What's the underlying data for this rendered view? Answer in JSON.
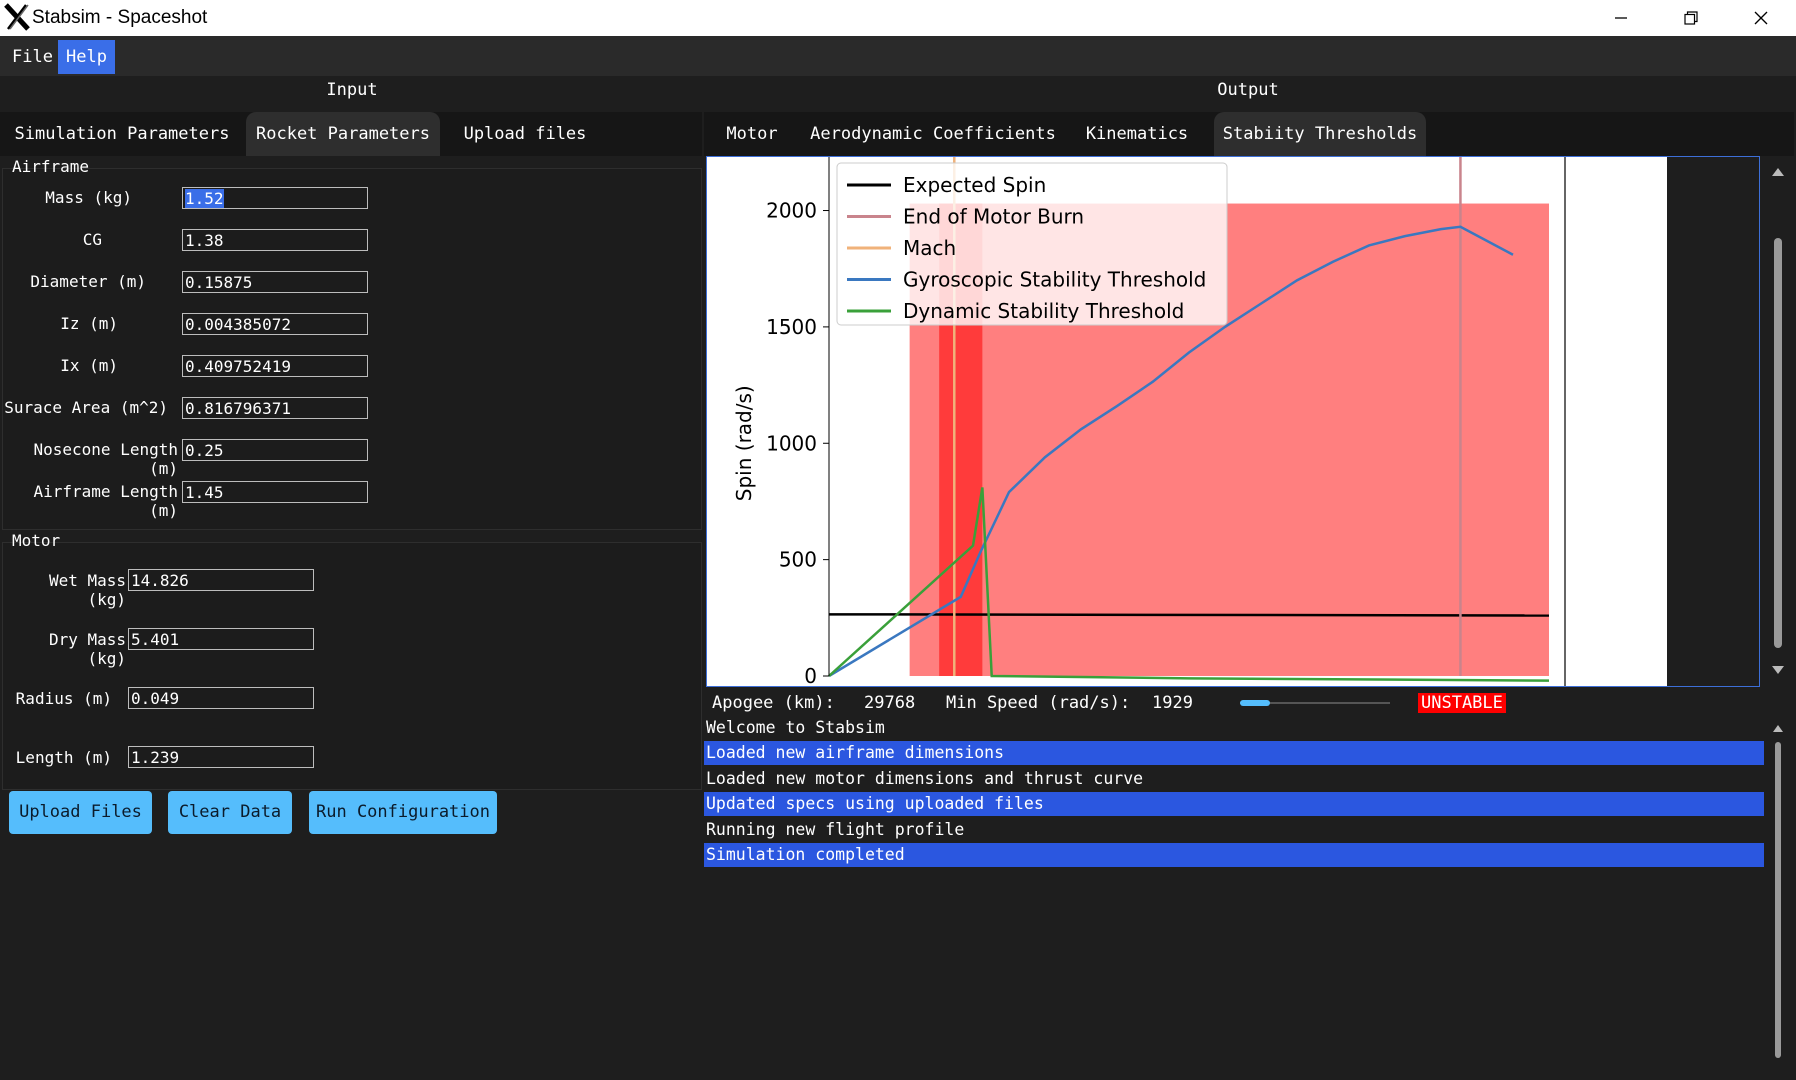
{
  "window": {
    "title": "Stabsim - Spaceshot"
  },
  "menu": {
    "items": [
      "File",
      "Help"
    ]
  },
  "panels": {
    "input_heading": "Input",
    "output_heading": "Output"
  },
  "input_tabs": [
    "Simulation Parameters",
    "Rocket Parameters",
    "Upload files"
  ],
  "input_selected_tab": "Rocket Parameters",
  "output_tabs": [
    "Motor",
    "Aerodynamic Coefficients",
    "Kinematics",
    "Stabiity Thresholds"
  ],
  "output_selected_tab": "Stabiity Thresholds",
  "airframe": {
    "label": "Airframe",
    "fields": [
      {
        "label": "Mass (kg)",
        "value": "1.52"
      },
      {
        "label": "CG",
        "value": "1.38"
      },
      {
        "label": "Diameter (m)",
        "value": "0.15875"
      },
      {
        "label": "Iz (m)",
        "value": "0.004385072"
      },
      {
        "label": "Ix (m)",
        "value": "0.409752419"
      },
      {
        "label": "Surace Area (m^2)",
        "value": "0.816796371"
      },
      {
        "label": "Nosecone Length (m)",
        "value": "0.25"
      },
      {
        "label": "Airframe Length (m)",
        "value": "1.45"
      }
    ]
  },
  "motor": {
    "label": "Motor",
    "fields": [
      {
        "label": "Wet Mass (kg)",
        "value": "14.826"
      },
      {
        "label": "Dry Mass (kg)",
        "value": "5.401"
      },
      {
        "label": "Radius (m)",
        "value": "0.049"
      },
      {
        "label": "Length (m)",
        "value": "1.239"
      }
    ]
  },
  "buttons": {
    "upload": "Upload Files",
    "clear": "Clear Data",
    "run": "Run Configuration"
  },
  "status": {
    "apogee_label": "Apogee (km):",
    "apogee_value": "29768",
    "min_speed_label": "Min Speed (rad/s):",
    "min_speed_value": "1929",
    "slider_fraction": 0.2,
    "stability": "UNSTABLE"
  },
  "log": [
    {
      "text": "Welcome to Stabsim",
      "highlight": false
    },
    {
      "text": "Loaded new airframe dimensions",
      "highlight": true
    },
    {
      "text": "Loaded new motor dimensions and thrust curve",
      "highlight": false
    },
    {
      "text": "Updated specs using uploaded files",
      "highlight": true
    },
    {
      "text": "Running new flight profile",
      "highlight": false
    },
    {
      "text": "Simulation completed",
      "highlight": true
    }
  ],
  "chart_data": {
    "type": "line",
    "ylabel": "Spin (rad/s)",
    "ylim": [
      0,
      2230
    ],
    "xlim": [
      0,
      1
    ],
    "yticks": [
      0,
      500,
      1000,
      1500,
      2000
    ],
    "legend_position": "top-left",
    "series": [
      {
        "name": "Expected Spin",
        "color": "#000000",
        "x": [
          0.0,
          1.0
        ],
        "y": [
          265,
          260
        ]
      },
      {
        "name": "End of Motor Burn",
        "color": "#c9848c",
        "x": [
          0.877,
          0.877
        ],
        "y": [
          0,
          2230
        ]
      },
      {
        "name": "Mach",
        "color": "#f0b27a",
        "x": [
          0.174,
          0.174
        ],
        "y": [
          0,
          2230
        ]
      },
      {
        "name": "Gyroscopic Stability Threshold",
        "color": "#3a78c0",
        "x": [
          0.0,
          0.183,
          0.21,
          0.25,
          0.3,
          0.35,
          0.4,
          0.45,
          0.5,
          0.55,
          0.6,
          0.65,
          0.7,
          0.75,
          0.8,
          0.85,
          0.877,
          0.95
        ],
        "y": [
          0,
          340,
          530,
          790,
          940,
          1060,
          1160,
          1265,
          1390,
          1500,
          1600,
          1700,
          1780,
          1850,
          1890,
          1920,
          1930,
          1810
        ]
      },
      {
        "name": "Dynamic Stability Threshold",
        "color": "#3aa03a",
        "x": [
          0.0,
          0.2,
          0.213,
          0.226,
          0.5,
          1.0
        ],
        "y": [
          0,
          560,
          810,
          0,
          -10,
          -20
        ]
      }
    ],
    "regions": [
      {
        "x_start": 0.112,
        "x_end": 1.0,
        "y_start": 0,
        "y_end": 2030,
        "color": "#ff7f7f"
      },
      {
        "x_start": 0.153,
        "x_end": 0.213,
        "y_start": 0,
        "y_end": 2030,
        "color": "#ff3b3b"
      }
    ]
  }
}
